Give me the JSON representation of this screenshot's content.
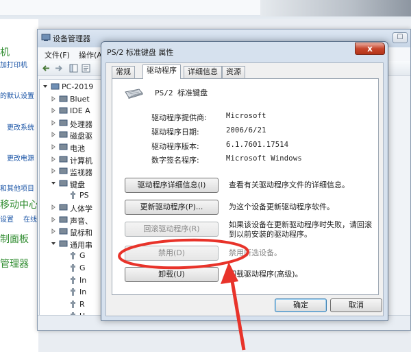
{
  "control_panel": {
    "items": [
      {
        "text": "机",
        "style": "green big"
      },
      {
        "text": "加打印机",
        "style": "blue small"
      },
      {
        "text": "的默认设置",
        "style": "blue small"
      },
      {
        "text": "更改系统",
        "style": "blue small"
      },
      {
        "text": "更改电源",
        "style": "blue small"
      },
      {
        "text": "和其他项目",
        "style": "blue small"
      },
      {
        "text": "移动中心",
        "style": "green big"
      },
      {
        "text": "设置",
        "style": "blue small"
      },
      {
        "text": "在线",
        "style": "blue small"
      },
      {
        "text": "制面板",
        "style": "green big"
      },
      {
        "text": "管理器",
        "style": "green big"
      }
    ]
  },
  "device_manager": {
    "title": "设备管理器",
    "menu": {
      "file": "文件(F)",
      "action": "操作(A"
    },
    "tree": [
      {
        "label": "PC-2019",
        "level": 0
      },
      {
        "label": "Bluet",
        "level": 1
      },
      {
        "label": "IDE A",
        "level": 1
      },
      {
        "label": "处理器",
        "level": 1
      },
      {
        "label": "磁盘驱",
        "level": 1
      },
      {
        "label": "电池",
        "level": 1
      },
      {
        "label": "计算机",
        "level": 1
      },
      {
        "label": "监视器",
        "level": 1
      },
      {
        "label": "键盘",
        "level": 1
      },
      {
        "label": "PS",
        "level": 2
      },
      {
        "label": "人体学",
        "level": 1
      },
      {
        "label": "声音、",
        "level": 1
      },
      {
        "label": "鼠标和",
        "level": 1
      },
      {
        "label": "通用串",
        "level": 1
      },
      {
        "label": "G",
        "level": 2
      },
      {
        "label": "G",
        "level": 2
      },
      {
        "label": "In",
        "level": 2
      },
      {
        "label": "In",
        "level": 2
      },
      {
        "label": "R",
        "level": 2
      },
      {
        "label": "U",
        "level": 2
      }
    ]
  },
  "dialog": {
    "title": "PS/2 标准键盘 属性",
    "close_label": "x",
    "tabs": [
      "常规",
      "驱动程序",
      "详细信息",
      "资源"
    ],
    "active_tab": 1,
    "device_name": "PS/2 标准键盘",
    "info": [
      {
        "label": "驱动程序提供商:",
        "value": "Microsoft"
      },
      {
        "label": "驱动程序日期:",
        "value": "2006/6/21"
      },
      {
        "label": "驱动程序版本:",
        "value": "6.1.7601.17514"
      },
      {
        "label": "数字签名程序:",
        "value": "Microsoft Windows"
      }
    ],
    "buttons": [
      {
        "label": "驱动程序详细信息(I)",
        "desc": "查看有关驱动程序文件的详细信息。",
        "enabled": true
      },
      {
        "label": "更新驱动程序(P)...",
        "desc": "为这个设备更新驱动程序软件。",
        "enabled": true
      },
      {
        "label": "回滚驱动程序(R)",
        "desc": "如果该设备在更新驱动程序时失败，请回滚到以前安装的驱动程序。",
        "enabled": false
      },
      {
        "label": "禁用(D)",
        "desc": "禁用所选设备。",
        "enabled": false
      },
      {
        "label": "卸载(U)",
        "desc": "卸载驱动程序(高级)。",
        "enabled": true
      }
    ],
    "ok_label": "确定",
    "cancel_label": "取消"
  },
  "colors": {
    "annotation": "#e8332a",
    "link_blue": "#1a54a6",
    "heading_green": "#2e8b2e"
  }
}
